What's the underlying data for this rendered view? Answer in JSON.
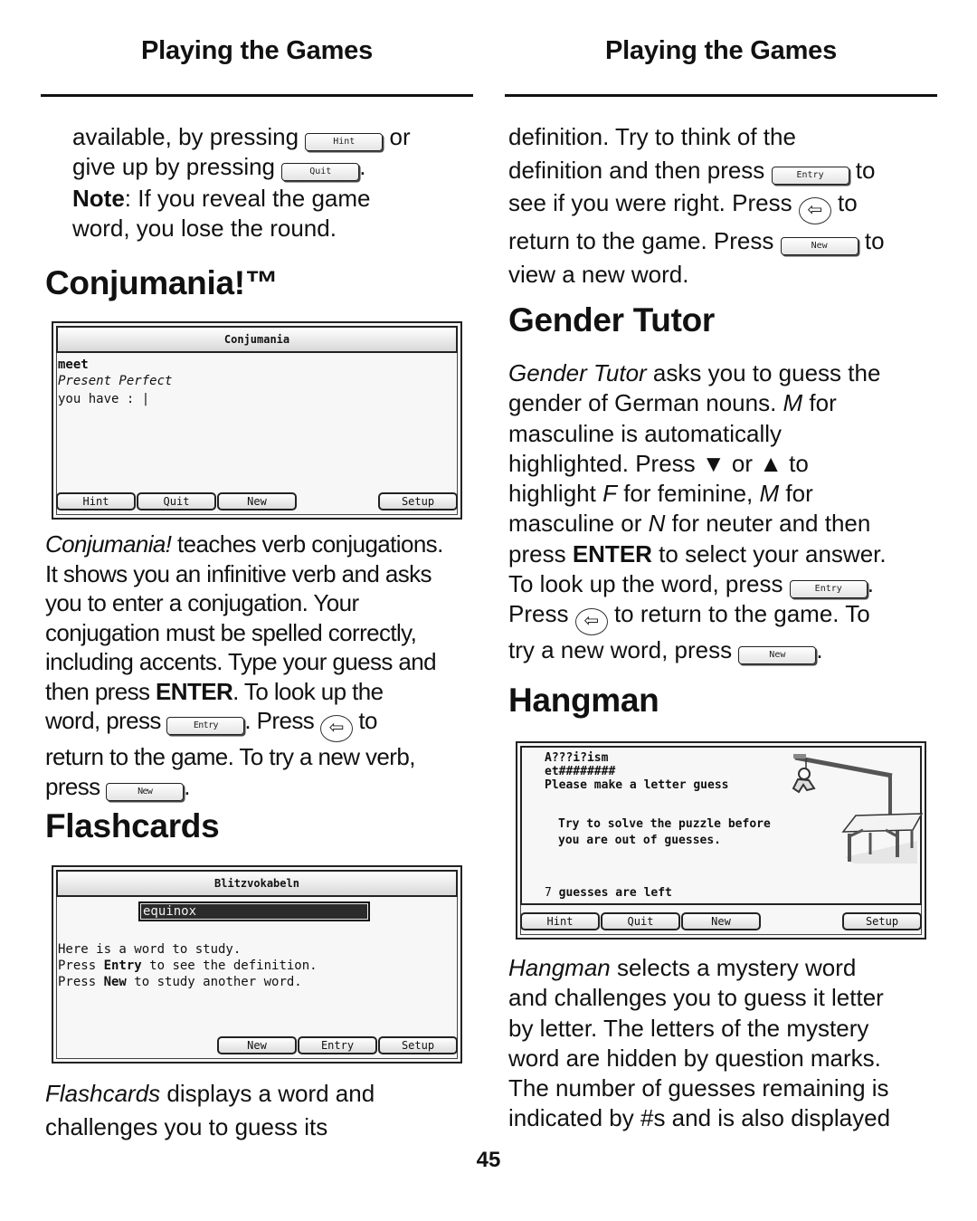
{
  "header": {
    "left_title": "Playing the Games",
    "right_title": "Playing the Games"
  },
  "keys": {
    "hint": "Hint",
    "quit": "Quit",
    "entry": "Entry",
    "new": "New",
    "setup": "Setup",
    "back_arrow": "⇦"
  },
  "left": {
    "intro": {
      "l1a": "available, by pressing",
      "l1b": "or",
      "l2a": "give up by pressing",
      "l2b": ".",
      "note_label": "Note",
      "note_text1": ": If you reveal the game",
      "note_text2": "word, you lose the round."
    },
    "conjumania": {
      "heading": "Conjumania!™",
      "screen": {
        "title": "Conjumania",
        "verb": "meet",
        "tense": "Present Perfect",
        "prompt": "you have : |",
        "buttons": [
          "Hint",
          "Quit",
          "New",
          "Setup"
        ]
      },
      "desc": {
        "name": "Conjumania!",
        "l1": " teaches verb conjugations.",
        "l2": "It shows you an infinitive verb and asks",
        "l3": "you to enter a conjugation. Your",
        "l4": "conjugation must be spelled correctly,",
        "l5": "including accents. Type your guess and",
        "l6a": "then press ",
        "l6b": "ENTER",
        "l6c": ". To look up the",
        "l7a": "word, press",
        "l7b": ". Press",
        "l7c": "to",
        "l8": "return to the game. To try a new verb,",
        "l9a": "press",
        "l9b": "."
      }
    },
    "flashcards": {
      "heading": "Flashcards",
      "screen": {
        "title": "Blitzvokabeln",
        "word": "equinox",
        "line1": "Here is a word to study.",
        "line2a": "Press ",
        "line2b": "Entry",
        "line2c": " to see the definition.",
        "line3a": "Press ",
        "line3b": "New",
        "line3c": " to study another word.",
        "buttons": [
          "New",
          "Entry",
          "Setup"
        ]
      },
      "desc": {
        "name": "Flashcards",
        "l1": " displays a word and",
        "l2": "challenges you to guess its"
      }
    }
  },
  "right": {
    "flash_cont": {
      "l1": "definition. Try to think of the",
      "l2a": "definition and then press",
      "l2b": "to",
      "l3a": "see if you were right. Press",
      "l3b": "to",
      "l4a": "return to the game. Press",
      "l4b": "to",
      "l5": "view a new word."
    },
    "gender_tutor": {
      "heading": "Gender Tutor",
      "desc": {
        "name": "Gender Tutor",
        "l1": " asks you to guess the",
        "l2a": "gender of German nouns. ",
        "l2m": "M",
        "l2b": " for",
        "l3": "masculine is automatically",
        "l4": "highlighted. Press ▼ or ▲ to",
        "l5a": "highlight ",
        "l5f": "F",
        "l5b": " for feminine, ",
        "l5m": "M",
        "l5c": " for",
        "l6a": "masculine or ",
        "l6n": "N",
        "l6b": " for neuter and then",
        "l7a": "press ",
        "l7b": "ENTER",
        "l7c": " to select your answer.",
        "l8a": "To look up the word, press",
        "l8b": ".",
        "l9a": "Press",
        "l9b": "to return to the game. To",
        "l10a": "try a new word, press",
        "l10b": "."
      }
    },
    "hangman": {
      "heading": "Hangman",
      "screen": {
        "puzzle": "A???i?ism",
        "guesses_marks": "et########",
        "instruction": "Please make a letter guess",
        "hint1": "Try to solve the puzzle before",
        "hint2": "you are out of guesses.",
        "guesses_count": "7",
        "guesses_label": "guesses are left",
        "buttons": [
          "Hint",
          "Quit",
          "New",
          "Setup"
        ]
      },
      "desc": {
        "name": "Hangman",
        "l1": " selects a mystery word",
        "l2": "and challenges you to guess it letter",
        "l3": "by letter. The letters of the mystery",
        "l4": "word are hidden by question marks.",
        "l5": "The number of guesses remaining is",
        "l6": "indicated by #s and is also displayed"
      }
    }
  },
  "footer": {
    "page_number": "45"
  }
}
